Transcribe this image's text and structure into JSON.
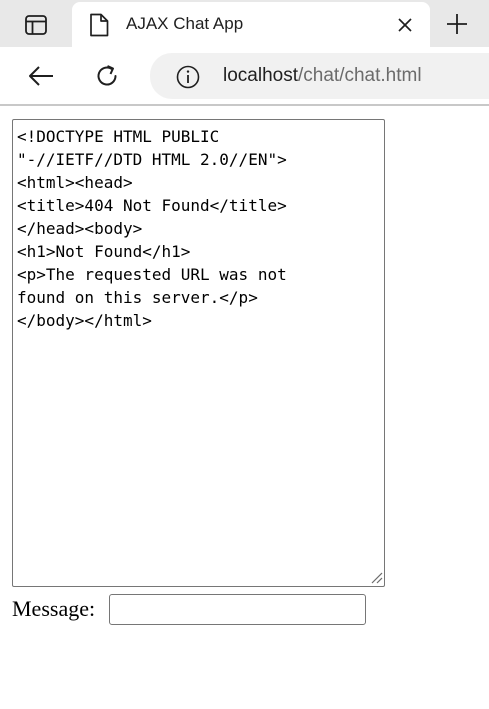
{
  "browser": {
    "tab": {
      "title": "AJAX Chat App",
      "favicon": "page-icon"
    },
    "address": {
      "host": "localhost",
      "path": "/chat/chat.html"
    },
    "icons": {
      "tab_actions": "tab-actions-icon",
      "close": "close-icon",
      "new_tab": "plus-icon",
      "back": "back-arrow-icon",
      "reload": "reload-icon",
      "site_info": "info-icon"
    }
  },
  "chat": {
    "log": "<!DOCTYPE HTML PUBLIC\n\"-//IETF//DTD HTML 2.0//EN\">\n<html><head>\n<title>404 Not Found</title>\n</head><body>\n<h1>Not Found</h1>\n<p>The requested URL was not\nfound on this server.</p>\n</body></html>",
    "message_label": "Message:",
    "message_value": ""
  },
  "colors": {
    "tabstrip": "#e8e8e8",
    "address_bar": "#f1f1f1",
    "border": "#767676"
  }
}
